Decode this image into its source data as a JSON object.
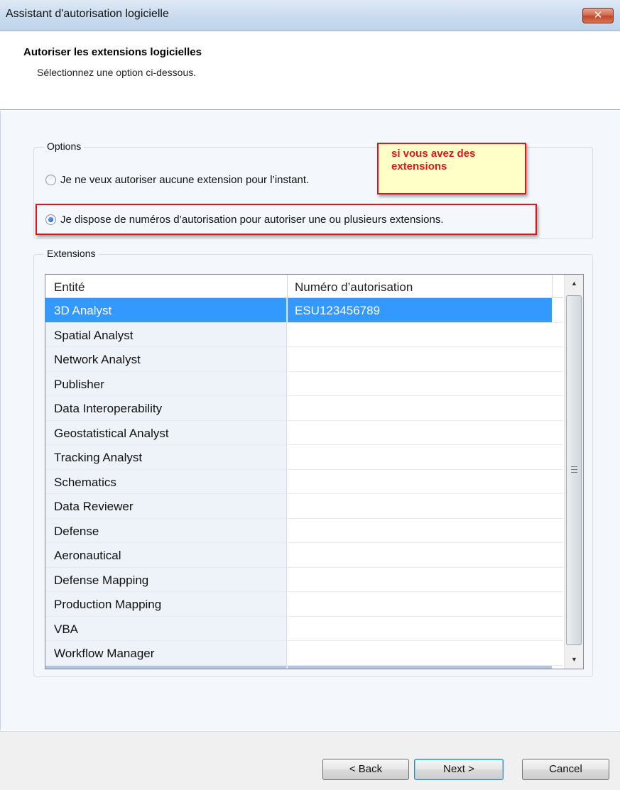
{
  "window": {
    "title": "Assistant d'autorisation logicielle",
    "close_glyph": "✕"
  },
  "header": {
    "title": "Autoriser les extensions logicielles",
    "subtitle": "Sélectionnez une option ci-dessous."
  },
  "options": {
    "legend": "Options",
    "radio_none_label": "Je ne veux autoriser aucune extension pour l’instant.",
    "radio_have_numbers_label": "Je dispose de numéros d’autorisation pour autoriser une ou plusieurs extensions.",
    "selected": "radio_have_numbers"
  },
  "annotation": {
    "text": "si vous avez des extensions",
    "color": "#e2141c",
    "background": "#ffffc8"
  },
  "extensions": {
    "legend": "Extensions",
    "columns": [
      "Entité",
      "Numéro d’autorisation"
    ],
    "rows": [
      {
        "entity": "3D Analyst",
        "number": "ESU123456789",
        "selected": true
      },
      {
        "entity": "Spatial Analyst",
        "number": ""
      },
      {
        "entity": "Network Analyst",
        "number": ""
      },
      {
        "entity": "Publisher",
        "number": ""
      },
      {
        "entity": "Data Interoperability",
        "number": ""
      },
      {
        "entity": "Geostatistical Analyst",
        "number": ""
      },
      {
        "entity": "Tracking Analyst",
        "number": ""
      },
      {
        "entity": "Schematics",
        "number": ""
      },
      {
        "entity": "Data Reviewer",
        "number": ""
      },
      {
        "entity": "Defense",
        "number": ""
      },
      {
        "entity": "Aeronautical",
        "number": ""
      },
      {
        "entity": "Defense Mapping",
        "number": ""
      },
      {
        "entity": "Production Mapping",
        "number": ""
      },
      {
        "entity": "VBA",
        "number": ""
      },
      {
        "entity": "Workflow Manager",
        "number": ""
      }
    ],
    "scroll_up_glyph": "▲",
    "scroll_down_glyph": "▼"
  },
  "buttons": {
    "back": "< Back",
    "next": "Next >",
    "cancel": "Cancel"
  },
  "colors": {
    "selection": "#3399ff",
    "highlight_border": "#e2141c"
  }
}
